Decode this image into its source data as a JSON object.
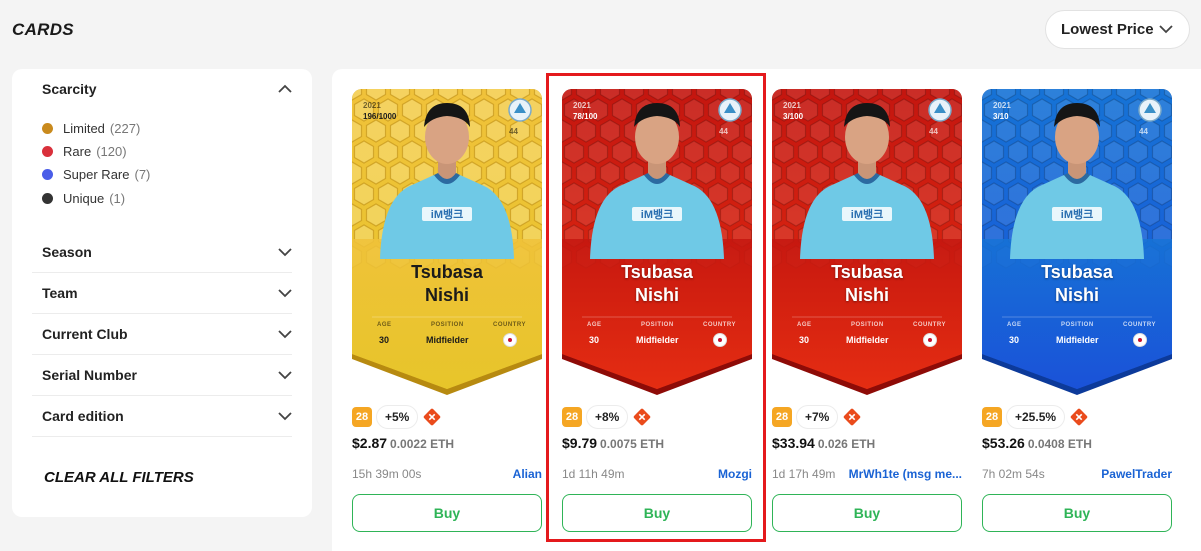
{
  "page_title": "CARDS",
  "sort": {
    "label": "Lowest Price"
  },
  "sidebar": {
    "scarcity_title": "Scarcity",
    "rarities": [
      {
        "label": "Limited",
        "count": "(227)",
        "color": "#c98a1d"
      },
      {
        "label": "Rare",
        "count": "(120)",
        "color": "#d9303b"
      },
      {
        "label": "Super Rare",
        "count": "(7)",
        "color": "#4a5de8"
      },
      {
        "label": "Unique",
        "count": "(1)",
        "color": "#333333"
      }
    ],
    "sections": [
      "Season",
      "Team",
      "Current Club",
      "Serial Number",
      "Card edition"
    ],
    "clear_label": "CLEAR ALL FILTERS"
  },
  "cards": [
    {
      "rarity": "limited",
      "season": "2021",
      "serial": "196/1000",
      "number": "44",
      "first_name": "Tsubasa",
      "last_name": "Nishi",
      "age_label": "AGE",
      "position_label": "POSITION",
      "country_label": "COUNTRY",
      "age": "30",
      "position": "Midfielder",
      "level": "28",
      "bonus": "+5%",
      "price": "$2.87",
      "eth": "0.0022 ETH",
      "time": "15h 39m 00s",
      "seller": "Alian",
      "buy_label": "Buy",
      "colors": {
        "top": "#f0c23a",
        "bottom": "#e7c52a",
        "edge": "#b78a10"
      }
    },
    {
      "rarity": "rare",
      "season": "2021",
      "serial": "78/100",
      "number": "44",
      "first_name": "Tsubasa",
      "last_name": "Nishi",
      "age_label": "AGE",
      "position_label": "POSITION",
      "country_label": "COUNTRY",
      "age": "30",
      "position": "Midfielder",
      "level": "28",
      "bonus": "+8%",
      "price": "$9.79",
      "eth": "0.0075 ETH",
      "time": "1d 11h 49m",
      "seller": "Mozgi",
      "buy_label": "Buy",
      "colors": {
        "top": "#c4160f",
        "bottom": "#e52d12",
        "edge": "#8e0b07"
      }
    },
    {
      "rarity": "rare",
      "season": "2021",
      "serial": "3/100",
      "number": "44",
      "first_name": "Tsubasa",
      "last_name": "Nishi",
      "age_label": "AGE",
      "position_label": "POSITION",
      "country_label": "COUNTRY",
      "age": "30",
      "position": "Midfielder",
      "level": "28",
      "bonus": "+7%",
      "price": "$33.94",
      "eth": "0.026 ETH",
      "time": "1d 17h 49m",
      "seller": "MrWh1te (msg me...",
      "buy_label": "Buy",
      "colors": {
        "top": "#c4160f",
        "bottom": "#e52d12",
        "edge": "#8e0b07"
      }
    },
    {
      "rarity": "super-rare",
      "season": "2021",
      "serial": "3/10",
      "number": "44",
      "first_name": "Tsubasa",
      "last_name": "Nishi",
      "age_label": "AGE",
      "position_label": "POSITION",
      "country_label": "COUNTRY",
      "age": "30",
      "position": "Midfielder",
      "level": "28",
      "bonus": "+25.5%",
      "price": "$53.26",
      "eth": "0.0408 ETH",
      "time": "7h 02m 54s",
      "seller": "PawelTrader",
      "buy_label": "Buy",
      "colors": {
        "top": "#1673d6",
        "bottom": "#1a52d8",
        "edge": "#0c3a9a"
      }
    }
  ],
  "accents": {
    "buy": "#2fb457",
    "link": "#1a63d4",
    "level": "#f5a623",
    "highlight": "#e4191c"
  }
}
